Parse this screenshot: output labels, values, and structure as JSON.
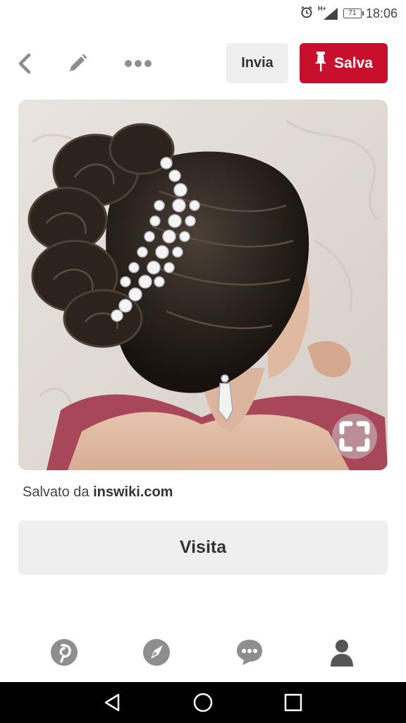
{
  "status_bar": {
    "time": "18:06",
    "battery_level": "71",
    "network_label": "H+",
    "icons": [
      "alarm-icon",
      "signal-icon",
      "battery-icon"
    ]
  },
  "toolbar": {
    "back_icon": "chevron-left-icon",
    "edit_icon": "pencil-icon",
    "more_icon": "more-horizontal-icon",
    "send_label": "Invia",
    "save_label": "Salva",
    "save_icon": "pin-icon"
  },
  "pin": {
    "image_subject": "bridal updo with jeweled headband",
    "lens_icon": "visual-search-icon",
    "saved_from_prefix": "Salvato da",
    "saved_from_domain": "inswiki.com",
    "visit_label": "Visita"
  },
  "bottom_nav": {
    "items": [
      "pinterest-home-icon",
      "explore-compass-icon",
      "messages-icon",
      "profile-icon"
    ]
  },
  "system_nav": {
    "items": [
      "back-triangle-icon",
      "home-circle-icon",
      "recents-square-icon"
    ]
  },
  "colors": {
    "accent": "#c8102e",
    "button_gray": "#efefef",
    "icon_gray": "#8e8e8e",
    "text_dark": "#333333"
  }
}
